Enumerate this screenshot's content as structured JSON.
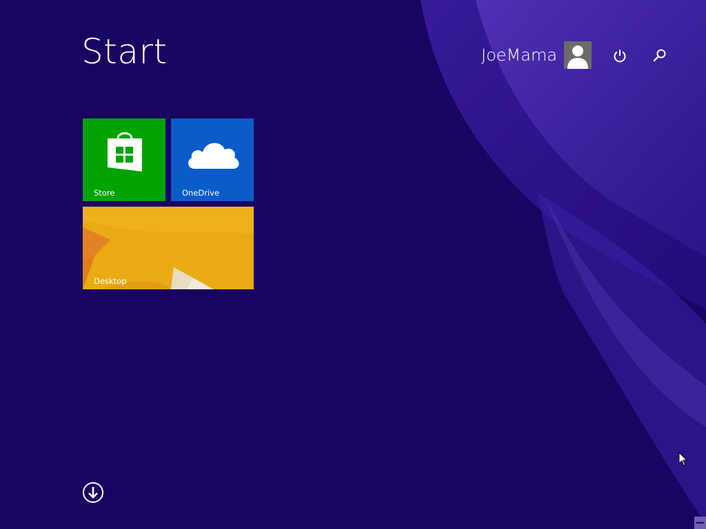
{
  "start_screen": {
    "title": "Start",
    "background_color": "#1a0461"
  },
  "user": {
    "name": "JoeMama",
    "avatar_icon": "user-silhouette-icon"
  },
  "header_actions": {
    "power_icon": "power-icon",
    "search_icon": "search-icon"
  },
  "tiles": [
    {
      "label": "Store",
      "icon": "store-bag-icon",
      "color": "#00a300"
    },
    {
      "label": "OneDrive",
      "icon": "cloud-icon",
      "color": "#0a5cc8"
    },
    {
      "label": "Desktop",
      "icon": "desktop-wallpaper",
      "color": "#e8a815"
    }
  ],
  "footer": {
    "all_apps_icon": "arrow-down-circle-icon"
  }
}
